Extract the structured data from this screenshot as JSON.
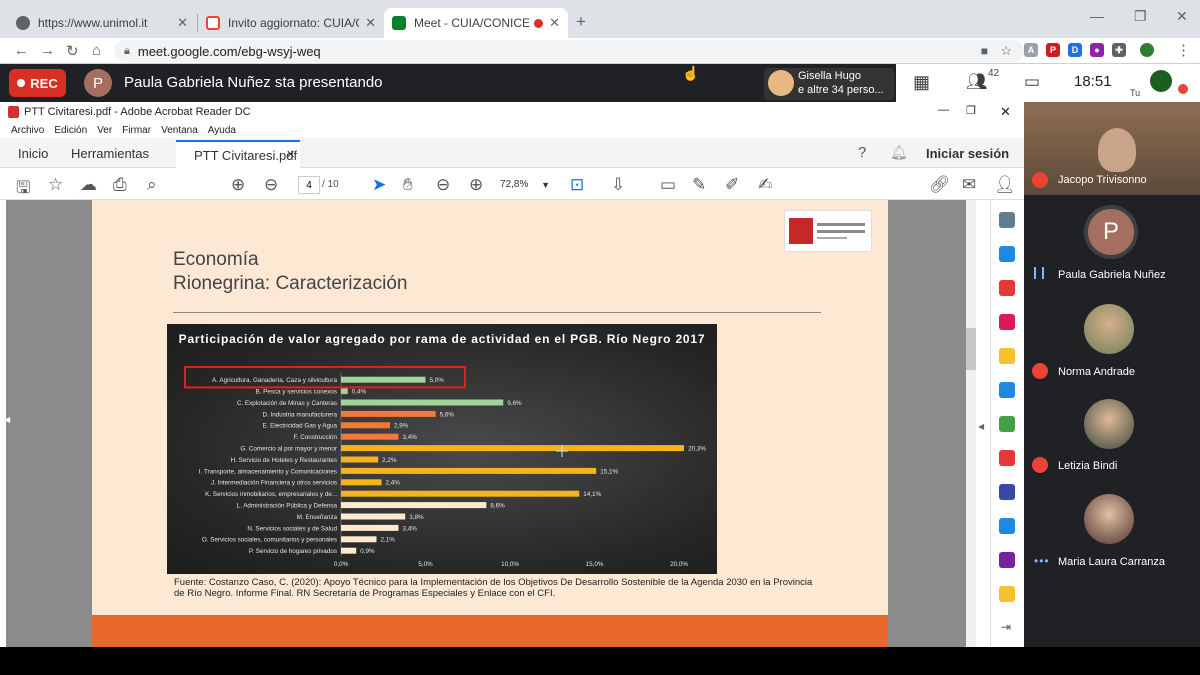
{
  "browser": {
    "tabs": [
      {
        "label": "https://www.unimol.it",
        "fav_color": "#5f6368"
      },
      {
        "label": "Invito aggiornato: CUIA/CONICET",
        "fav_color": "#ea4335"
      },
      {
        "label": "Meet - CUIA/CONICET: WEB",
        "fav_color": "#00832d"
      }
    ],
    "new_tab": "+",
    "url": "meet.google.com/ebg-wsyj-weq"
  },
  "meet": {
    "rec_label": "REC",
    "presenter_initial": "P",
    "presenting_text": "Paula Gabriela Nuñez sta presentando",
    "viewer_name": "Gisella Hugo",
    "viewer_more": "e altre 34 perso...",
    "people_count": "42",
    "time": "18:51",
    "me_label": "Tu"
  },
  "acrobat": {
    "title": "PTT Civitaresi.pdf - Adobe Acrobat Reader DC",
    "menu": [
      "Archivo",
      "Edición",
      "Ver",
      "Firmar",
      "Ventana",
      "Ayuda"
    ],
    "tab_inicio": "Inicio",
    "tab_tools": "Herramientas",
    "tab_doc": "PTT Civitaresi.pdf",
    "sign_in": "Iniciar sesión",
    "page_current": "4",
    "page_total": "/ 10",
    "zoom": "72,8%"
  },
  "slide": {
    "title_line1": "Economía",
    "title_line2": "Rionegrina:  Caracterización",
    "source": "Fuente:  Costanzo Caso, C. (2020): Apoyo Técnico para la Implementación de los Objetivos De Desarrollo Sostenible de la Agenda 2030 en la Provincia de Río Negro. Informe Final.  RN Secretaría de Programas Especiales y Enlace con el CFI."
  },
  "chart_data": {
    "type": "bar",
    "orientation": "horizontal",
    "title": "Participación de valor agregado por rama de actividad en el PGB. Río Negro 2017",
    "categories": [
      "A. Agricultura, Ganadería, Caza y silvicultura",
      "B. Pesca y servicios conexos",
      "C. Explotación de Minas y Canteras",
      "D. Industria manufacturera",
      "E. Electricidad Gas y Agua",
      "F. Construcción",
      "G. Comercio al por mayor y menor",
      "H. Servicio de Hoteles y Restaurantes",
      "I. Transporte, almacenamiento y Comunicaciones",
      "J. Intermediación Financiera y otros servicios",
      "K. Servicios inmobiliarios, empresariales y de...",
      "L. Administración Pública y Defensa",
      "M. Enseñanza",
      "N. Servicios sociales y de Salud",
      "O. Servicios sociales, comunitarios y personales",
      "P. Servicio de hogares privados"
    ],
    "values": [
      5.0,
      0.4,
      9.6,
      5.6,
      2.9,
      3.4,
      20.3,
      2.2,
      15.1,
      2.4,
      14.1,
      8.6,
      3.8,
      3.4,
      2.1,
      0.9
    ],
    "value_labels": [
      "5,0%",
      "0,4%",
      "9,6%",
      "5,6%",
      "2,9%",
      "3,4%",
      "20,3%",
      "2,2%",
      "15,1%",
      "2,4%",
      "14,1%",
      "8,6%",
      "3,8%",
      "3,4%",
      "2,1%",
      "0,9%"
    ],
    "colors": [
      "#9fd49a",
      "#9fd49a",
      "#9fd49a",
      "#f07a3a",
      "#f07a3a",
      "#f07a3a",
      "#f5b31c",
      "#f5b31c",
      "#f5b31c",
      "#f5b31c",
      "#f5b31c",
      "#fde9d0",
      "#fde9d0",
      "#fde9d0",
      "#fde9d0",
      "#fde9d0"
    ],
    "x_ticks": [
      "0,0%",
      "5,0%",
      "10,0%",
      "15,0%",
      "20,0%"
    ],
    "xlim": [
      0,
      20
    ],
    "highlighted_category_index": 0,
    "highlight_color": "#e02020"
  },
  "participants": [
    {
      "name": "Jacopo Trivisonno",
      "muted": true
    },
    {
      "name": "Paula Gabriela Nuñez",
      "initial": "P",
      "speaking": true
    },
    {
      "name": "Norma Andrade",
      "muted": true
    },
    {
      "name": "Letizia Bindi",
      "muted": true
    },
    {
      "name": "Maria Laura Carranza",
      "more": true
    }
  ]
}
